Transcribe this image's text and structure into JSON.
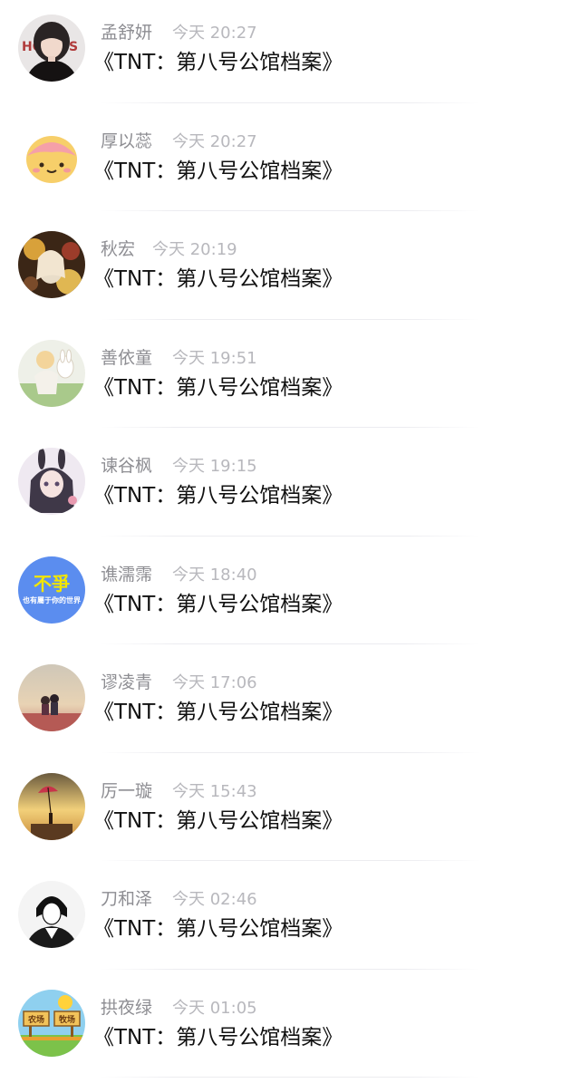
{
  "messages": [
    {
      "name": "孟舒妍",
      "time": "今天 20:27",
      "title": "《TNT：第八号公馆档案》",
      "avatar": "portrait-woman-dark-hair"
    },
    {
      "name": "厚以蕊",
      "time": "今天 20:27",
      "title": "《TNT：第八号公馆档案》",
      "avatar": "cartoon-potato-face"
    },
    {
      "name": "秋宏",
      "time": "今天 20:19",
      "title": "《TNT：第八号公馆档案》",
      "avatar": "anime-floral-girl"
    },
    {
      "name": "善依童",
      "time": "今天 19:51",
      "title": "《TNT：第八号公馆档案》",
      "avatar": "anime-girl-with-rabbit"
    },
    {
      "name": "谏谷枫",
      "time": "今天 19:15",
      "title": "《TNT：第八号公馆档案》",
      "avatar": "anime-bunny-ears-girl"
    },
    {
      "name": "谯濡霈",
      "time": "今天 18:40",
      "title": "《TNT：第八号公馆档案》",
      "avatar": "text-avatar-bu-zheng",
      "avatar_text": {
        "main": "不爭",
        "sub": "也有屬于你的世界"
      }
    },
    {
      "name": "谬凌青",
      "time": "今天 17:06",
      "title": "《TNT：第八号公馆档案》",
      "avatar": "couple-sunset-photo"
    },
    {
      "name": "厉一璇",
      "time": "今天 15:43",
      "title": "《TNT：第八号公馆档案》",
      "avatar": "girl-with-umbrella-sunset"
    },
    {
      "name": "刀和泽",
      "time": "今天 02:46",
      "title": "《TNT：第八号公馆档案》",
      "avatar": "monochrome-sketch-boy"
    },
    {
      "name": "拱夜绿",
      "time": "今天 01:05",
      "title": "《TNT：第八号公馆档案》",
      "avatar": "farm-sign-cartoon",
      "avatar_text": {
        "left": "农场",
        "right": "牧场"
      }
    }
  ],
  "colors": {
    "name": "#8e8e93",
    "time": "#b8b8bd",
    "title": "#111111",
    "avatar_blue": "#5b8def",
    "avatar_yellow": "#f2e600"
  }
}
